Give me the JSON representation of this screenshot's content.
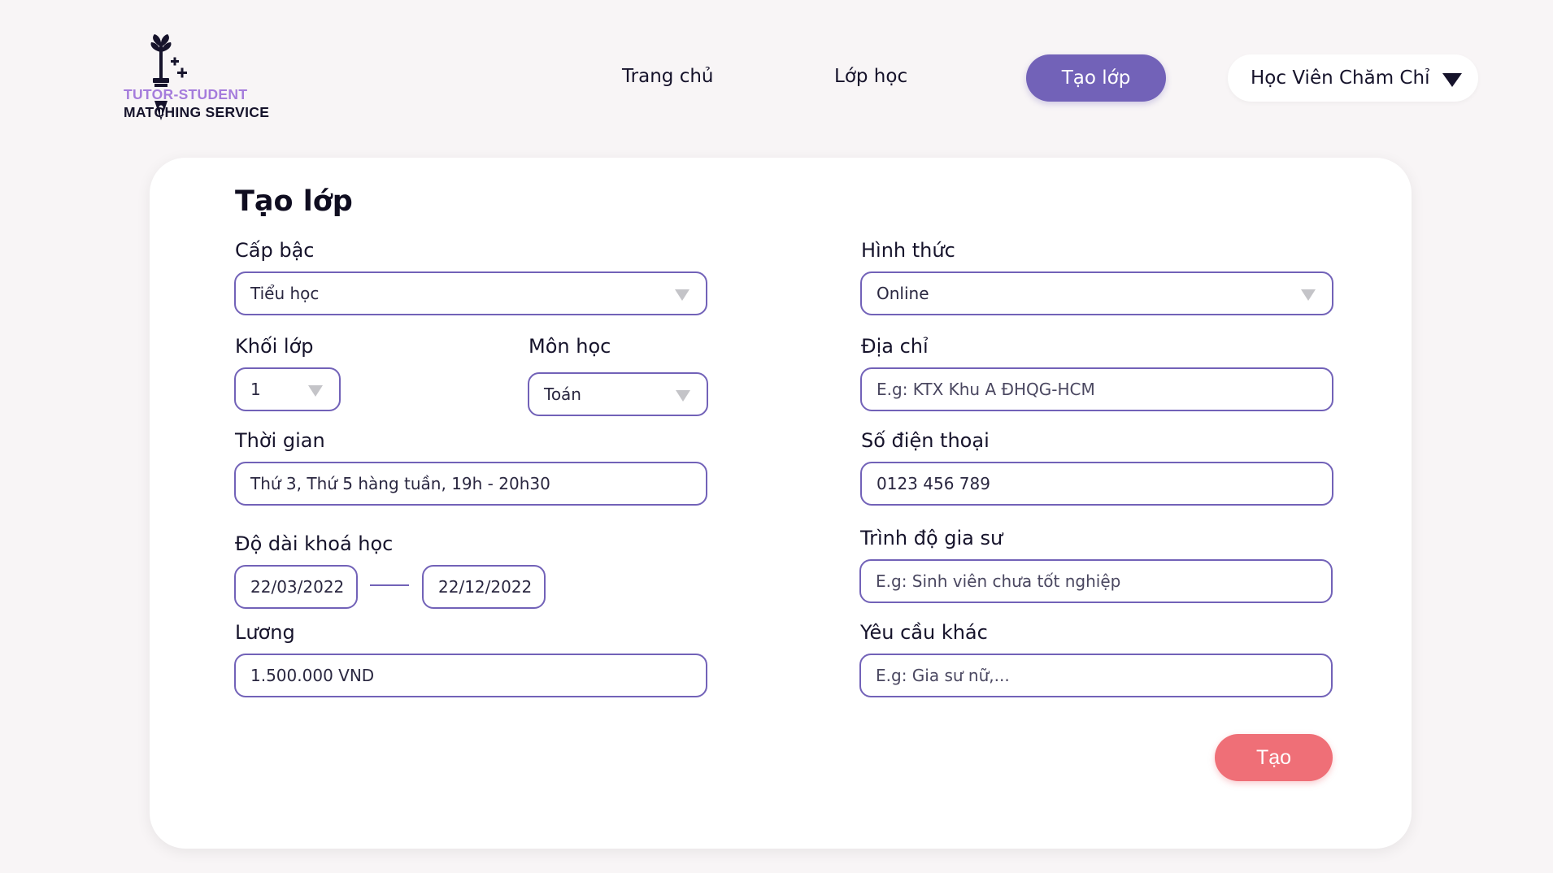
{
  "brand": {
    "line1": "TUTOR-STUDENT",
    "line2": "MATCHING SERVICE"
  },
  "nav": {
    "home": "Trang chủ",
    "classes": "Lớp học",
    "create_class": "Tạo lớp",
    "user_name": "Học Viên Chăm Chỉ"
  },
  "form": {
    "title": "Tạo lớp",
    "level": {
      "label": "Cấp bậc",
      "value": "Tiểu học"
    },
    "grade": {
      "label": "Khối lớp",
      "value": "1"
    },
    "subject": {
      "label": "Môn học",
      "value": "Toán"
    },
    "schedule": {
      "label": "Thời gian",
      "value": "Thứ 3, Thứ 5 hàng tuần, 19h - 20h30"
    },
    "duration": {
      "label": "Độ dài khoá học",
      "start": "22/03/2022",
      "end": "22/12/2022"
    },
    "salary": {
      "label": "Lương",
      "value": "1.500.000 VND"
    },
    "mode": {
      "label": "Hình thức",
      "value": "Online"
    },
    "address": {
      "label": "Địa chỉ",
      "placeholder": "E.g: KTX Khu A ĐHQG-HCM"
    },
    "phone": {
      "label": "Số điện thoại",
      "value": "0123 456 789"
    },
    "tutor_level": {
      "label": "Trình độ gia sư",
      "placeholder": "E.g: Sinh viên chưa tốt nghiệp"
    },
    "other": {
      "label": "Yêu cầu khác",
      "placeholder": "E.g: Gia sư nữ,..."
    },
    "submit_label": "Tạo"
  },
  "colors": {
    "accent": "#7262b8",
    "brand_purple": "#a57cdc",
    "submit": "#ef6f77",
    "background": "#f8f5f6"
  },
  "icons": {
    "logo": "plant-pen-icon",
    "user_caret": "caret-down-icon",
    "select_caret": "triangle-down-icon"
  }
}
